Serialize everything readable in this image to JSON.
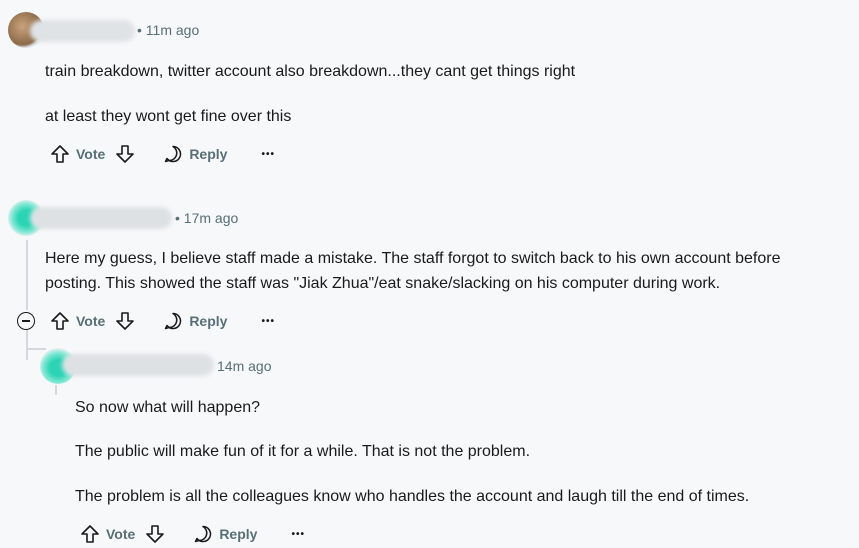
{
  "comments": [
    {
      "time": "• 11m ago",
      "paragraphs": [
        "train breakdown, twitter account also breakdown...they cant get things right",
        "at least they wont get fine over this"
      ],
      "vote_label": "Vote",
      "reply_label": "Reply",
      "more_label": "•••"
    },
    {
      "time": "• 17m ago",
      "paragraphs": [
        "Here my guess, I believe staff made a mistake. The staff forgot to switch back to his own account before",
        "posting. This showed the staff was \"Jiak Zhua\"/eat snake/slacking on his computer during work."
      ],
      "vote_label": "Vote",
      "reply_label": "Reply",
      "more_label": "•••"
    },
    {
      "time": "14m ago",
      "paragraphs": [
        "So now what will happen?",
        "The public will make fun of it for a while. That is not the problem.",
        "The problem is all the colleagues know who handles the account and laugh till the end of times."
      ],
      "vote_label": "Vote",
      "reply_label": "Reply",
      "more_label": "•••"
    }
  ],
  "colors": {
    "meta_text": "#576f76",
    "thread_line": "#d4d8da",
    "avatar_teal": "#2bd4b4"
  },
  "icons": [
    "upvote-icon",
    "downvote-icon",
    "reply-bubble-icon",
    "more-options-icon",
    "collapse-thread-icon"
  ]
}
